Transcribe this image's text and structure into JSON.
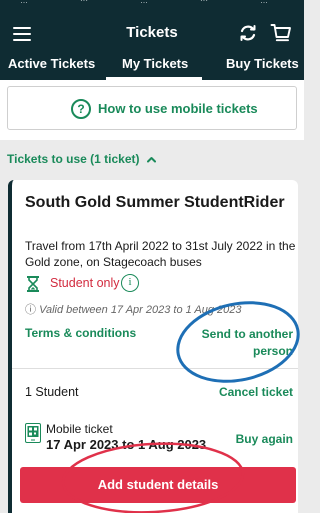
{
  "header": {
    "title": "Tickets",
    "status_clip": [
      "…",
      "···",
      "…",
      "···",
      "…"
    ]
  },
  "tabs": [
    {
      "label": "Active Tickets",
      "active": false
    },
    {
      "label": "My Tickets",
      "active": true
    },
    {
      "label": "Buy Tickets",
      "active": false
    }
  ],
  "howto": {
    "icon": "?",
    "label": "How to use mobile tickets"
  },
  "section": {
    "label": "Tickets to use  (1 ticket)",
    "chevron": "^"
  },
  "ticket": {
    "title": "South Gold Summer StudentRider",
    "description": "Travel from 17th April 2022 to 31st July 2022 in the Gold zone, on Stagecoach buses",
    "restriction": "Student only",
    "info_icon": "i",
    "valid_icon": "ⓘ",
    "valid": "Valid between 17 Apr 2023 to 1 Aug 2023",
    "terms": "Terms & conditions",
    "send": "Send to another person",
    "passenger": "1 Student",
    "cancel": "Cancel ticket",
    "mobile_label": "Mobile ticket",
    "dates": "17 Apr 2023 to 1 Aug 2023",
    "buy_again": "Buy again",
    "add_button": "Add student details"
  },
  "colors": {
    "header": "#0f2c33",
    "accent_green": "#1a8a5a",
    "alert_red": "#d22b3f",
    "button_red": "#e0314a",
    "annotation_blue": "#1e6fb5",
    "annotation_red": "#e0314a"
  }
}
